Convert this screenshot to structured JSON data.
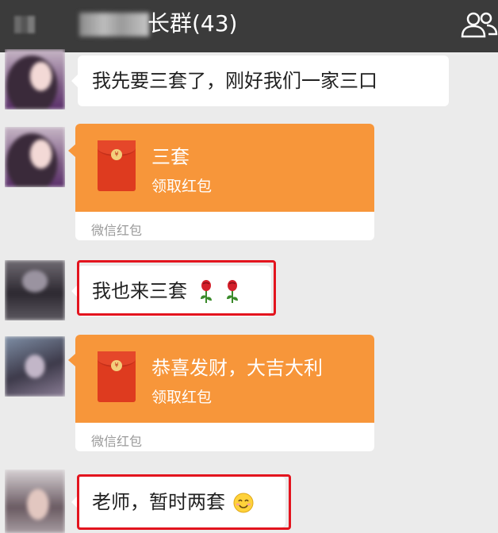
{
  "header": {
    "title_suffix": "长群(43)",
    "icon": "group-members-icon",
    "background": "#3b3b3b"
  },
  "messages": [
    {
      "type": "text",
      "text": "我先要三套了，刚好我们一家三口"
    },
    {
      "type": "red_packet",
      "title": "三套",
      "action": "领取红包",
      "footer": "微信红包"
    },
    {
      "type": "text",
      "text": "我也来三套",
      "emoji": [
        "rose-emoji",
        "rose-emoji"
      ],
      "highlighted": true
    },
    {
      "type": "red_packet",
      "title": "恭喜发财，大吉大利",
      "action": "领取红包",
      "footer": "微信红包"
    },
    {
      "type": "text",
      "text": "老师，暂时两套",
      "emoji": [
        "smile-emoji"
      ],
      "highlighted": true
    }
  ],
  "colors": {
    "red_packet": "#f7963a",
    "highlight_box": "#e3141e",
    "chat_background": "#ebebeb"
  }
}
